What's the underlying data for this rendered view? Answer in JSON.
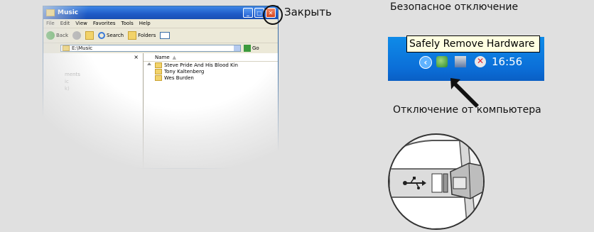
{
  "explorer": {
    "title": "Music",
    "menu": [
      "File",
      "Edit",
      "View",
      "Favorites",
      "Tools",
      "Help"
    ],
    "toolbar": {
      "back": "Back",
      "search": "Search",
      "folders": "Folders"
    },
    "address": "E:\\Music",
    "go": "Go",
    "left_pane_close": "×",
    "left_pane_faint": [
      "ments",
      "ic",
      "k)"
    ],
    "column_name": "Name",
    "files": [
      "Steve Pride And His Blood Kin",
      "Tony Kaltenberg",
      "Wes Burden"
    ],
    "window_buttons": {
      "minimize": "_",
      "maximize": "□",
      "close": "✕"
    }
  },
  "labels": {
    "close": "Закрыть",
    "safe_remove": "Безопасное отключение",
    "disconnect": "Отключение от компьютера"
  },
  "tray": {
    "tooltip": "Safely Remove Hardware",
    "clock": "16:56",
    "chevron": "‹"
  },
  "icons": {
    "safe_remove_icon": "usb-safe-remove-icon",
    "network_icon": "network-icon",
    "security_icon": "security-alert-icon",
    "usb_symbol": "usb-icon"
  },
  "colors": {
    "titlebar": "#1e5bc7",
    "taskbar": "#0b6fd8",
    "tooltip_bg": "#ffffe1",
    "close_btn": "#d8461c"
  }
}
